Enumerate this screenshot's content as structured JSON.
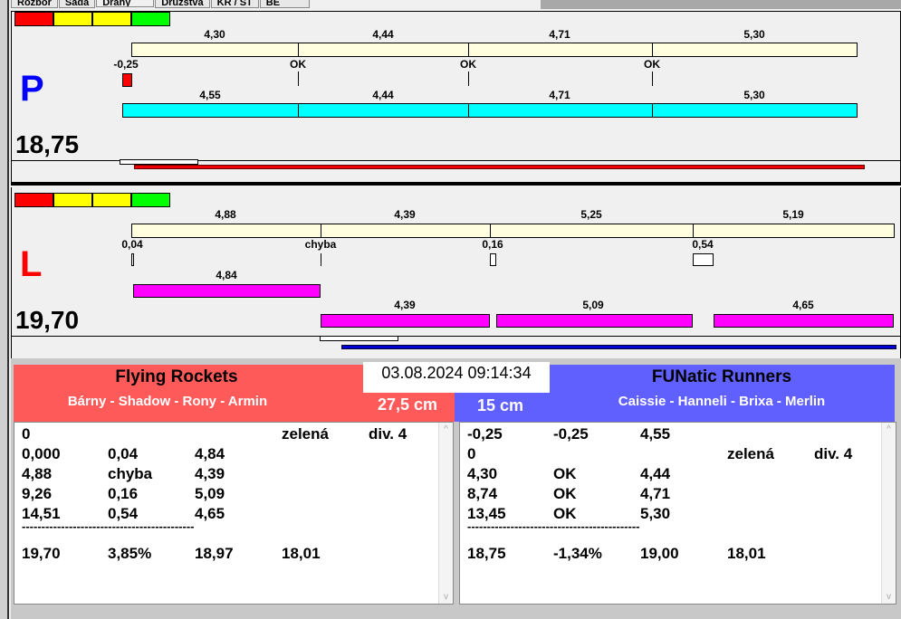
{
  "tabs": [
    "Rozbor",
    "Sada",
    "Dráhy",
    "Družstva",
    "KR / ST",
    "BE"
  ],
  "colors": {
    "red": "#ff0000",
    "yellow": "#ffff00",
    "green": "#00ff00",
    "cyan": "#00ffff",
    "magenta": "#ff00ff",
    "team_left": "#ff5a5a",
    "team_right": "#6060ff"
  },
  "laneP": {
    "letter": "P",
    "score": "18,75",
    "top_labels": [
      "4,30",
      "4,44",
      "4,71",
      "5,30"
    ],
    "mid_labels": [
      "-0,25",
      "OK",
      "OK",
      "OK"
    ],
    "bottom_labels": [
      "4,55",
      "4,44",
      "4,71",
      "5,30"
    ]
  },
  "laneL": {
    "letter": "L",
    "score": "19,70",
    "top_labels": [
      "4,88",
      "4,39",
      "5,25",
      "5,19"
    ],
    "mid_labels": [
      "0,04",
      "chyba",
      "0,16",
      "0,54"
    ],
    "low_labels": [
      "4,84"
    ],
    "bottom_labels": [
      "4,39",
      "5,09",
      "4,65"
    ]
  },
  "datetime": "03.08.2024 09:14:34",
  "left_team": {
    "name": "Flying Rockets",
    "players": "Bárny - Shadow - Rony - Armin",
    "distance": "27,5 cm",
    "rows": [
      [
        "0",
        "",
        "",
        "zelená",
        "div. 4"
      ],
      [
        "0,000",
        "0,04",
        "4,84",
        "",
        ""
      ],
      [
        "4,88",
        "chyba",
        "4,39",
        "",
        ""
      ],
      [
        "9,26",
        "0,16",
        "5,09",
        "",
        ""
      ],
      [
        "14,51",
        "0,54",
        "4,65",
        "",
        ""
      ]
    ],
    "separator": "--------------------------------------------",
    "total": [
      "19,70",
      "3,85%",
      "18,97",
      "18,01"
    ]
  },
  "right_team": {
    "name": "FUNatic Runners",
    "players": "Caissie - Hanneli - Brixa - Merlin",
    "distance": "15 cm",
    "rows": [
      [
        "-0,25",
        "-0,25",
        "4,55",
        "",
        ""
      ],
      [
        "0",
        "",
        "",
        "zelená",
        "div. 4"
      ],
      [
        "4,30",
        "OK",
        "4,44",
        "",
        ""
      ],
      [
        "8,74",
        "OK",
        "4,71",
        "",
        ""
      ],
      [
        "13,45",
        "OK",
        "5,30",
        "",
        ""
      ]
    ],
    "separator": "--------------------------------------------",
    "total": [
      "18,75",
      "-1,34%",
      "19,00",
      "18,01"
    ]
  }
}
